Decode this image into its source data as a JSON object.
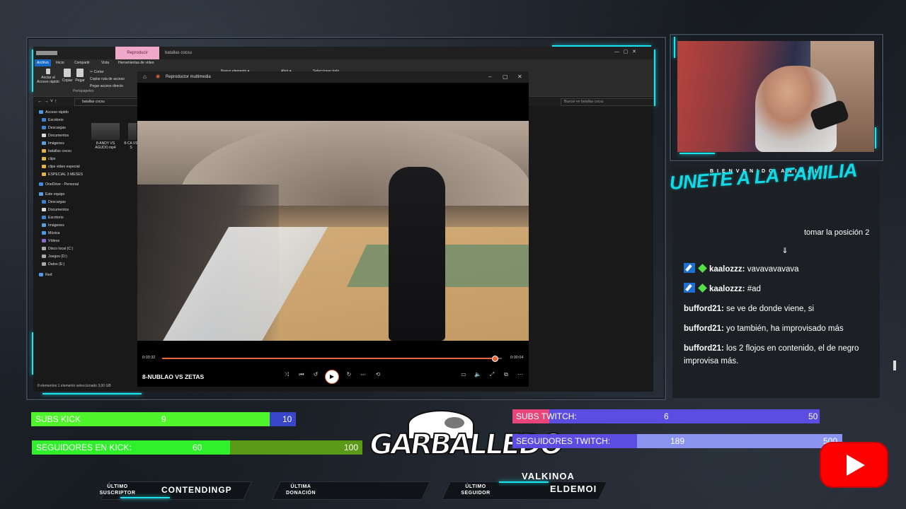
{
  "explorer": {
    "tab_label": "Reproducir",
    "path_title": "batallas cocsu",
    "ribbon_tabs": [
      "Archivo",
      "Inicio",
      "Compartir",
      "Vista",
      "Herramientas de vídeo"
    ],
    "ribbon_buttons": [
      "Anclar al Acceso rápido",
      "Copiar",
      "Pegar"
    ],
    "ribbon_small": [
      "Cortar",
      "Copiar ruta de acceso",
      "Pegar acceso directo"
    ],
    "ribbon_extra": [
      "Nuevo elemento ▾",
      "Abrir ▾",
      "Seleccionar todo"
    ],
    "group_label": "Portapapeles",
    "address": "batallas cocsu",
    "search_placeholder": "Buscar en batallas cocsu",
    "nav_items": [
      {
        "label": "Acceso rápido",
        "color": "#4a9be8"
      },
      {
        "label": "Escritorio",
        "color": "#3c83d6"
      },
      {
        "label": "Descargas",
        "color": "#3c83d6"
      },
      {
        "label": "Documentos",
        "color": "#d9d9d9"
      },
      {
        "label": "Imágenes",
        "color": "#5aa0e0"
      },
      {
        "label": "batallas cocsu",
        "color": "#e3b442"
      },
      {
        "label": "clips",
        "color": "#e3b442"
      },
      {
        "label": "clips video especial",
        "color": "#e3b442"
      },
      {
        "label": "ESPECIAL 3 MESES",
        "color": "#e3b442"
      },
      {
        "label": "OneDrive - Personal",
        "color": "#3c8de0"
      },
      {
        "label": "Este equipo",
        "color": "#5aa0e0"
      },
      {
        "label": "Descargas",
        "color": "#3c83d6"
      },
      {
        "label": "Documentos",
        "color": "#d9d9d9"
      },
      {
        "label": "Escritorio",
        "color": "#3c83d6"
      },
      {
        "label": "Imágenes",
        "color": "#5aa0e0"
      },
      {
        "label": "Música",
        "color": "#4a9be8"
      },
      {
        "label": "Vídeos",
        "color": "#8a6ad8"
      },
      {
        "label": "Disco local (C:)",
        "color": "#aaaaaa"
      },
      {
        "label": "Juegos (D:)",
        "color": "#aaaaaa"
      },
      {
        "label": "Datos (E:)",
        "color": "#aaaaaa"
      },
      {
        "label": "Red",
        "color": "#4a9be8"
      }
    ],
    "files": [
      "8-ANDY VS AGUDO.mp4",
      "8-CA VS S"
    ],
    "status": "8 elementos   1 elemento seleccionado  3,00 GB"
  },
  "player": {
    "title": "Reproductor multimedia",
    "elapsed": "0:03:32",
    "remaining": "0:00:04",
    "progress_fraction": 0.98,
    "now_playing": "8-NUBLAO VS ZETAS"
  },
  "chat": {
    "welcome": "BIENVENIDO ANIMAL",
    "headline": "UNETE A LA FAMILIA",
    "cut_text": "tomar la posición 2",
    "messages": [
      {
        "user": "kaalozzz:",
        "text": "vavavavavava",
        "badges": true
      },
      {
        "user": "kaalozzz:",
        "text": "#ad",
        "badges": true
      },
      {
        "user": "bufford21:",
        "text": "se ve de donde viene, si",
        "badges": false
      },
      {
        "user": "bufford21:",
        "text": "yo también, ha improvisado más",
        "badges": false
      },
      {
        "user": "bufford21:",
        "text": "los 2 flojos en contenido, el de negro improvisa más.",
        "badges": false
      }
    ]
  },
  "goals": {
    "subs_kick": {
      "label": "SUBS KICK",
      "current": "9",
      "target": "10",
      "fraction": 0.9
    },
    "seg_kick": {
      "label": "SEGUIDORES EN KICK:",
      "current": "60",
      "target": "100",
      "fraction": 0.6
    },
    "subs_twitch": {
      "label": "SUBS TWITCH:",
      "current": "6",
      "target": "50",
      "fraction": 0.12
    },
    "seg_twitch": {
      "label": "SEGUIDORES TWITCH:",
      "current": "189",
      "target": "500",
      "fraction": 0.378
    }
  },
  "logo_text": "GARBALLEDO",
  "recent": {
    "sub_label_1": "ÚLTIMO",
    "sub_label_2": "SUSCRIPTOR",
    "sub_value": "CONTENDINGP",
    "don_label_1": "ÚLTIMA",
    "don_label_2": "DONACIÓN",
    "don_value": "",
    "fol_label_1": "ÚLTIMO",
    "fol_label_2": "SEGUIDOR",
    "fol_value_1": "VALKINOA",
    "fol_value_2": "ELDEMOI"
  },
  "colors": {
    "accent": "#19e6f0",
    "kick_green": "#4df52a",
    "kick_dark": "#5a9a16",
    "twitch_blue": "#5b4de0",
    "twitch_light": "#8b93f0",
    "twitch_pink": "#e8467a"
  },
  "icons": [
    "pin-icon",
    "copy-icon",
    "paste-icon",
    "scissors-icon",
    "play-icon",
    "shuffle-icon",
    "previous-icon",
    "replay-icon",
    "forward-icon",
    "next-icon",
    "repeat-icon",
    "miniplayer-icon",
    "volume-icon",
    "fullscreen-icon",
    "cast-icon",
    "more-icon",
    "youtube-icon",
    "moderator-badge-icon",
    "gem-badge-icon"
  ]
}
